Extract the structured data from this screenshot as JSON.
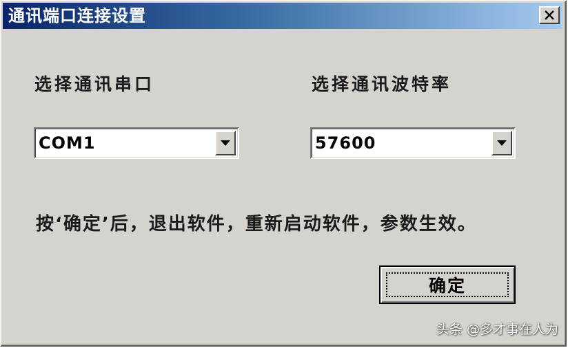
{
  "window": {
    "title": "通讯端口连接设置"
  },
  "port_section": {
    "label": "选择通讯串口",
    "value": "COM1"
  },
  "baud_section": {
    "label": "选择通讯波特率",
    "value": "57600"
  },
  "instruction": "按‘确定’后，退出软件，重新启动软件，参数生效。",
  "ok_button": {
    "label": "确定"
  },
  "watermark": "头条 @多才事在人为",
  "colors": {
    "dialog_background": "#d6d3ce",
    "title_gradient_start": "#0a246a",
    "title_gradient_end": "#a6caf0"
  },
  "icons": {
    "close": "close-icon",
    "dropdown": "chevron-down-icon"
  }
}
